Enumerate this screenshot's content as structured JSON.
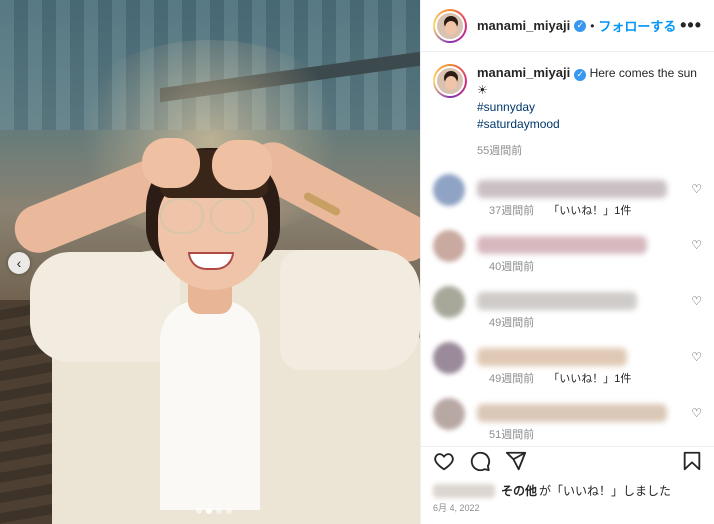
{
  "post": {
    "username": "manami_miyaji",
    "follow_label": "フォローする",
    "separator": "•",
    "more_label": "•••",
    "caption_text": "Here comes the sun ☀",
    "hashtags": [
      "#sunnyday",
      "#saturdaymood"
    ],
    "caption_time": "55週間前",
    "nav_prev": "‹",
    "date": "6月 4, 2022"
  },
  "comments": [
    {
      "time": "37週間前",
      "likes": "「いいね！」1件",
      "avatar_color": "#8fa3c4",
      "text_color": "#c9c0c4",
      "text_width": 190
    },
    {
      "time": "40週間前",
      "likes": "",
      "avatar_color": "#c9a9a0",
      "text_color": "#d7b8bf",
      "text_width": 170
    },
    {
      "time": "49週間前",
      "likes": "",
      "avatar_color": "#a8a89a",
      "text_color": "#cfcbc8",
      "text_width": 160
    },
    {
      "time": "49週間前",
      "likes": "「いいね！」1件",
      "avatar_color": "#9a8a9a",
      "text_color": "#e0c9b4",
      "text_width": 150
    },
    {
      "time": "51週間前",
      "likes": "",
      "avatar_color": "#b8a8a4",
      "text_color": "#dac7b6",
      "text_width": 190
    }
  ],
  "liked_by": {
    "others": "その他",
    "suffix": "が「いいね！」しました"
  },
  "colors": {
    "link": "#0095f6",
    "hashtag": "#00376b",
    "verified": "#3897f0"
  },
  "icons": {
    "heart": "heart-icon",
    "comment": "comment-icon",
    "share": "share-icon",
    "bookmark": "bookmark-icon"
  }
}
